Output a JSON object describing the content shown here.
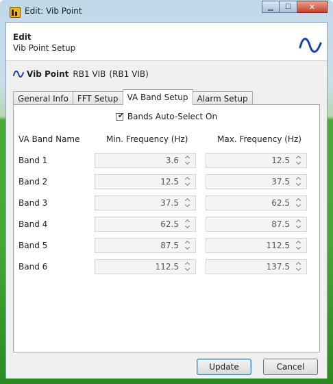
{
  "window": {
    "title": "Edit: Vib Point"
  },
  "icons": {
    "app": "app-logo-icon",
    "minimize": "minimize-icon",
    "maximize": "maximize-icon",
    "close": "close-icon",
    "waveform": "sine-wave-icon"
  },
  "header": {
    "title": "Edit",
    "subtitle": "Vib Point Setup"
  },
  "point": {
    "label": "Vib Point",
    "name": "RB1 VIB",
    "id": "(RB1 VIB)"
  },
  "tabs": [
    {
      "label": "General Info",
      "active": false
    },
    {
      "label": "FFT Setup",
      "active": false
    },
    {
      "label": "VA Band Setup",
      "active": true
    },
    {
      "label": "Alarm Setup",
      "active": false
    }
  ],
  "band_setup": {
    "auto_select": {
      "label": "Bands Auto-Select On",
      "checked": true
    },
    "columns": {
      "name": "VA Band Name",
      "min": "Min. Frequency (Hz)",
      "max": "Max. Frequency (Hz)"
    },
    "bands": [
      {
        "name": "Band 1",
        "min": "3.6",
        "max": "12.5"
      },
      {
        "name": "Band 2",
        "min": "12.5",
        "max": "37.5"
      },
      {
        "name": "Band 3",
        "min": "37.5",
        "max": "62.5"
      },
      {
        "name": "Band 4",
        "min": "62.5",
        "max": "87.5"
      },
      {
        "name": "Band 5",
        "min": "87.5",
        "max": "112.5"
      },
      {
        "name": "Band 6",
        "min": "112.5",
        "max": "137.5"
      }
    ]
  },
  "buttons": {
    "update": "Update",
    "cancel": "Cancel"
  },
  "colors": {
    "wave_blue": "#1a3fb0",
    "frame_green": "#48a536",
    "close_red": "#c2402a"
  }
}
